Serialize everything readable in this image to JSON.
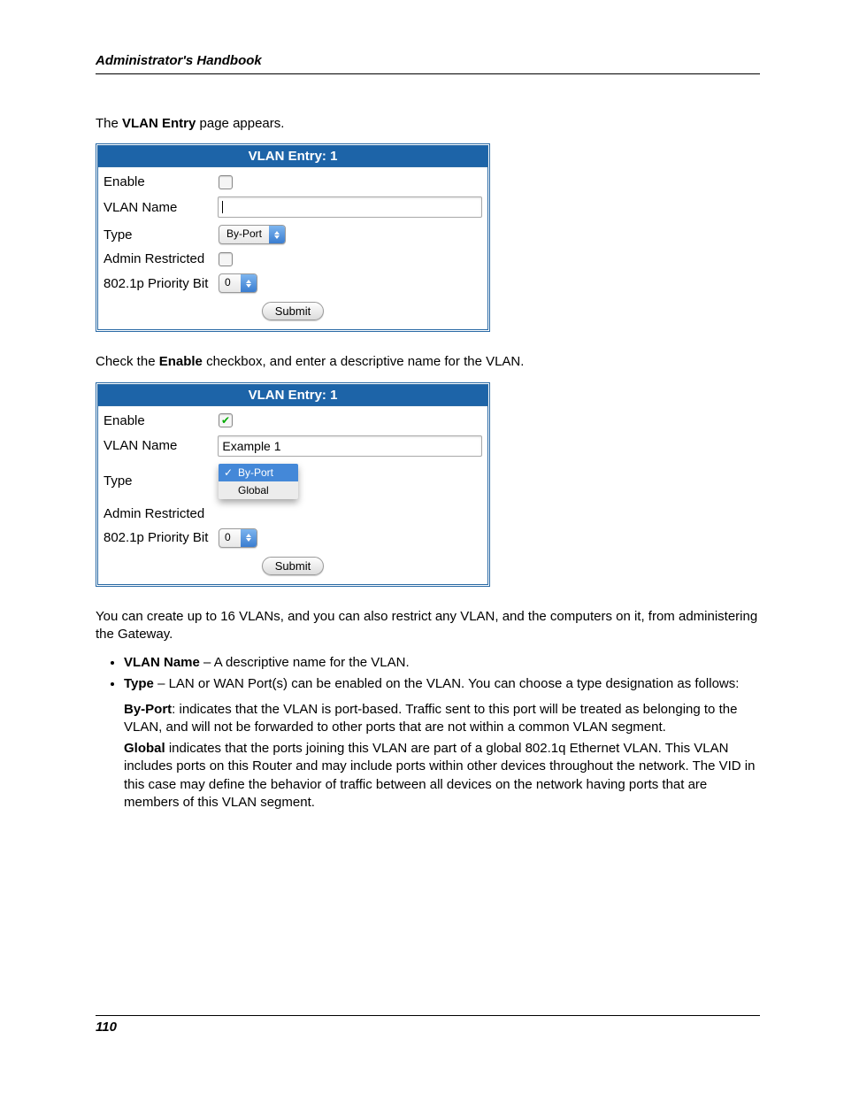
{
  "header": {
    "title": "Administrator's Handbook"
  },
  "intro": {
    "line1_pre": "The ",
    "line1_bold": "VLAN Entry",
    "line1_post": " page appears."
  },
  "panel1": {
    "title": "VLAN Entry: 1",
    "rows": {
      "enable": {
        "label": "Enable",
        "checked": false
      },
      "vlan_name": {
        "label": "VLAN Name",
        "value": ""
      },
      "type": {
        "label": "Type",
        "value": "By-Port"
      },
      "admin": {
        "label": "Admin Restricted",
        "checked": false
      },
      "priority": {
        "label": "802.1p Priority Bit",
        "value": "0"
      }
    },
    "submit": "Submit"
  },
  "mid_text": {
    "pre": "Check the ",
    "bold": "Enable",
    "post": " checkbox, and enter a descriptive name for the VLAN."
  },
  "panel2": {
    "title": "VLAN Entry: 1",
    "rows": {
      "enable": {
        "label": "Enable",
        "checked": true
      },
      "vlan_name": {
        "label": "VLAN Name",
        "value": "Example 1"
      },
      "type": {
        "label": "Type",
        "options": [
          "By-Port",
          "Global"
        ],
        "selected": "By-Port"
      },
      "admin": {
        "label": "Admin Restricted",
        "checked": false
      },
      "priority": {
        "label": "802.1p Priority Bit",
        "value": "0"
      }
    },
    "submit": "Submit"
  },
  "body_text": {
    "para": "You can create up to 16 VLANs, and you can also restrict any VLAN, and the computers on it, from administering the Gateway.",
    "b1_bold": "VLAN Name",
    "b1_rest": " – A descriptive name for the VLAN.",
    "b2_bold": "Type",
    "b2_rest": " – LAN or WAN Port(s) can be enabled on the VLAN. You can choose a type designation as follows:",
    "byport_bold": "By-Port",
    "byport_rest": ": indicates that the VLAN is port-based. Traffic sent to this port will be treated as belonging to the VLAN, and will not be forwarded to other ports that are not within a common VLAN segment.",
    "global_bold": "Global",
    "global_rest": " indicates that the ports joining this VLAN are part of a global 802.1q Ethernet VLAN. This VLAN includes ports on this Router and may include ports within other devices throughout the network. The VID in this case may define the behavior of traffic between all devices on the network having ports that are members of this VLAN segment."
  },
  "footer": {
    "page": "110"
  }
}
